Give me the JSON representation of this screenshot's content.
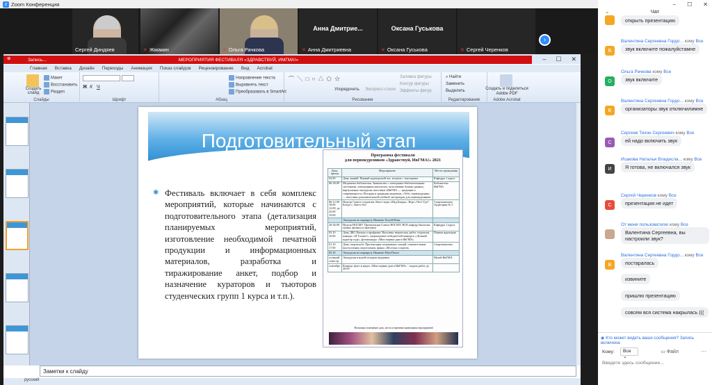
{
  "window": {
    "title": "Zoom Конференция"
  },
  "participants": [
    {
      "name": "Сергей Диндяев",
      "muted": false,
      "video": true
    },
    {
      "name": "Жмакин",
      "muted": true,
      "video": true
    },
    {
      "name": "Ольга Рачкова",
      "muted": true,
      "video": true
    },
    {
      "name": "Анна Дмитриевна",
      "display": "Анна Дмитрие...",
      "muted": true,
      "video": false
    },
    {
      "name": "Оксана Гуськова",
      "display": "Оксана Гуськова",
      "muted": true,
      "video": false
    },
    {
      "name": "Сергей Черенков",
      "muted": true,
      "video": false
    }
  ],
  "recording": {
    "label": "Запись...",
    "center": "МЕРОПРИЯТИЯ ФЕСТИВАЛЯ «ЗДРАВСТВУЙ, ИМГМА!»"
  },
  "ppt": {
    "menu": [
      "Главная",
      "Вставка",
      "Дизайн",
      "Переходы",
      "Анимация",
      "Показ слайдов",
      "Рецензирование",
      "Вид",
      "Acrobat"
    ],
    "ribbon": {
      "create_slide": "Создать слайд",
      "layout": "Макет",
      "reset": "Восстановить",
      "section": "Раздел",
      "group_slides": "Слайды",
      "group_font": "Шрифт",
      "group_paragraph": "Абзац",
      "text_direction": "Направление текста",
      "align_text": "Выровнять текст",
      "smartart": "Преобразовать в SmartArt",
      "group_drawing": "Рисование",
      "arrange": "Упорядочить",
      "quick_styles": "Экспресс-стили",
      "fill": "Заливка фигуры",
      "outline": "Контур фигуры",
      "effects": "Эффекты фигур",
      "find": "Найти",
      "replace": "Заменить",
      "select": "Выделить",
      "group_editing": "Редактирование",
      "adobe_share": "Создать и поделиться Adobe PDF",
      "group_acrobat": "Adobe Acrobat"
    },
    "slide": {
      "title": "Подготовительный этап",
      "bullet": "Фестиваль включает в себя комплекс мероприятий, которые начинаются с подготовительного этапа (детализация планируемых мероприятий, изготовление необходимой печатной продукции и информационных материалов, разработка и тиражирование анкет, подбор и назначение кураторов и тьюторов студенческих групп 1 курса и т.п.).",
      "program": {
        "title": "Программа фестиваля",
        "subtitle": "для первокурсников «Здравствуй, ИвГМА!» 2021",
        "headers": [
          "Дата, время",
          "Мероприятие",
          "Место проведения"
        ],
        "rows": [
          {
            "date": "02.09",
            "event": "День знаний. Первый кураторский час, встреча с тьюторами",
            "place": "Кафедры 1 курса",
            "hl": false
          },
          {
            "date": "06-30.09",
            "event": "Медиатека библиотеки. Знакомство с электронно-библиотечными системами, электронным каталогом, пользование базами данных, виртуальные экскурсии; выставки «ИвГМА — традиции и современность» История и традиции академии, «Тебе, первокурсник» — выставка дополнительной учебной литературы для первокурсников",
            "place": "Библиотека ИвГМА",
            "hl": false
          },
          {
            "date": "06-12.09 18.00 12.09, до 25.09 19.00",
            "event": "Недели Совета студентов. Квест-игра «Мед.Бокры». Игра «Что? Где? Когда?». Квест-бот",
            "place": "Спорткомплекс Аудитория № 3",
            "hl": false
          },
          {
            "date": "",
            "event": "Экскурсия по маршруту Иваново-Холуй-Южа",
            "place": "",
            "hl": true
          },
          {
            "date": "20-26.09",
            "event": "Неделя НОСМУ. Презентация Совета НОСМУ, НСК кафедр биологии, химии, физики и анатомии",
            "place": "Кафедры 1 курса",
            "hl": false
          },
          {
            "date": "03.10 10.00",
            "event": "День ДКС/Центра и профкома. Выставка творческих работ студентов, конкурс «И Талант!», награждение победителей конкурса «Лучший куратор года», фотоконкурс «Мои первые дни в ИвГМА»",
            "place": "Первая аудитория",
            "hl": false
          },
          {
            "date": "01.10 17.00",
            "event": "День спортклуба. Презентация спортивных секций, показательные выступления спортсменов, финал «Веселых стартов»",
            "place": "Спорткомплекс",
            "hl": false
          },
          {
            "date": "05.10",
            "event": "Экскурсия по маршруту Иваново-Шуя-Палех",
            "place": "",
            "hl": true
          },
          {
            "date": "осенний семестр",
            "event": "Экскурсия в музей истории академии",
            "place": "Музей ИвГМА",
            "hl": false
          },
          {
            "date": "сентябрь",
            "event": "Конкурс фото и видео «Мои первые дни в ИвГМА» - подача работ до 26.09",
            "place": "",
            "hl": false
          }
        ],
        "footer": "Возможно изменение дать, места и времени проведения мероприятий"
      }
    },
    "notes_label": "Заметки к слайду",
    "status": "русский"
  },
  "chat": {
    "title": "Чат",
    "messages": [
      {
        "sender": "",
        "to": "",
        "text": "открыть презентацию",
        "avatar": "",
        "color": "#f5a623"
      },
      {
        "sender": "Валентина Сергеевна Гордо...",
        "to": "Все",
        "text": "звук включите пожалуйстамне",
        "avatar": "В",
        "color": "#f5a623"
      },
      {
        "sender": "Ольга Рачкова",
        "to": "Все",
        "text": "звук включите",
        "avatar": "О",
        "color": "#27ae60"
      },
      {
        "sender": "Валентина Сергеевна Гордо...",
        "to": "Все",
        "text": "организаторы звук отключилимне",
        "avatar": "В",
        "color": "#f5a623"
      },
      {
        "sender": "Сергеев Тихон Сергеевич",
        "to": "Все",
        "text": "ей надо включить звук",
        "avatar": "С",
        "color": "#9b59b6"
      },
      {
        "sender": "Исакова Наталья Владисла...",
        "to": "Все",
        "text": "Я готова, не включался звук",
        "avatar": "И",
        "color": "#444444"
      },
      {
        "sender": "Сергей Черенков",
        "to": "Все",
        "text": "презентация не идет",
        "avatar": "С",
        "color": "#e74c3c"
      },
      {
        "sender": "От меня пользователю",
        "to": "Все",
        "text": "Валентина Сергеевна, вы настроили звук?",
        "avatar": "",
        "color": "#c9a890"
      },
      {
        "sender": "Валентина Сергеевна Гордо...",
        "to": "Все",
        "text": "постаралась",
        "avatar": "В",
        "color": "#f5a623"
      },
      {
        "sender": "",
        "to": "",
        "text": "извините",
        "avatar": "",
        "color": ""
      },
      {
        "sender": "",
        "to": "",
        "text": "пришлю презентацию",
        "avatar": "",
        "color": ""
      },
      {
        "sender": "",
        "to": "",
        "text": "совсем вся система накрылась (((",
        "avatar": "",
        "color": ""
      }
    ],
    "visibility": "Кто может видеть ваши сообщения? Запись включена",
    "to_label": "Кому:",
    "to_value": "Все",
    "file_label": "Файл",
    "input_placeholder": "Введите здесь сообщение..."
  }
}
